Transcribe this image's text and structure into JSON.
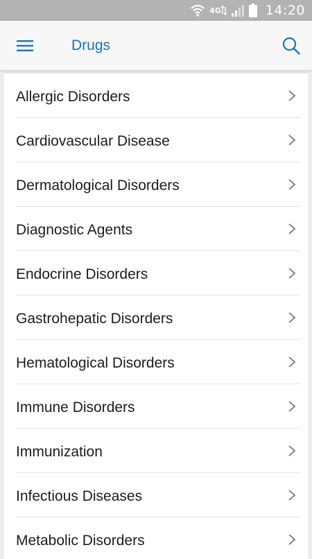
{
  "status_bar": {
    "network_type": "4G",
    "time": "14:20",
    "icons": [
      "wifi-icon",
      "network-4g-icon",
      "signal-icon",
      "battery-icon"
    ]
  },
  "app_bar": {
    "title": "Drugs",
    "menu_icon": "hamburger-menu-icon",
    "search_icon": "search-icon",
    "accent_color": "#1a73b8"
  },
  "categories": [
    {
      "label": "Allergic Disorders"
    },
    {
      "label": "Cardiovascular Disease"
    },
    {
      "label": "Dermatological Disorders"
    },
    {
      "label": "Diagnostic Agents"
    },
    {
      "label": "Endocrine Disorders"
    },
    {
      "label": "Gastrohepatic Disorders"
    },
    {
      "label": "Hematological Disorders"
    },
    {
      "label": "Immune Disorders"
    },
    {
      "label": "Immunization"
    },
    {
      "label": "Infectious Diseases"
    },
    {
      "label": "Metabolic Disorders"
    }
  ]
}
